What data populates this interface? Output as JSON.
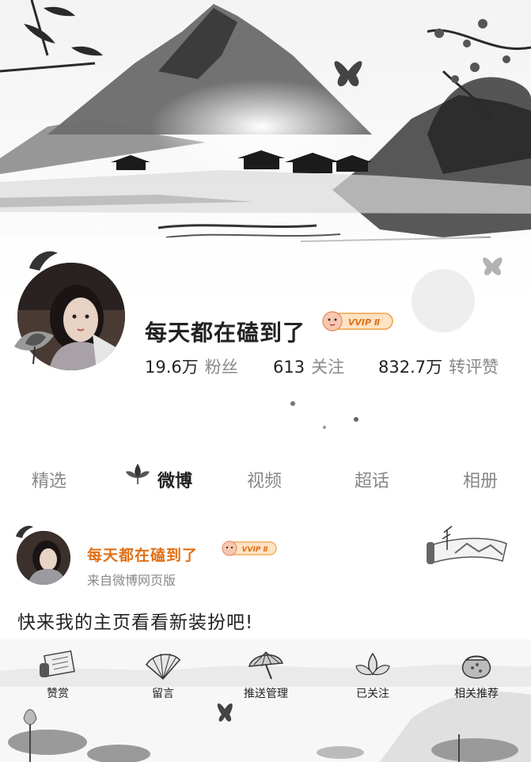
{
  "profile": {
    "username": "每天都在磕到了",
    "vip_badge": "VVIP Ⅱ",
    "stats": [
      {
        "value": "19.6万",
        "label": "粉丝"
      },
      {
        "value": "613",
        "label": "关注"
      },
      {
        "value": "832.7万",
        "label": "转评赞"
      }
    ]
  },
  "tabs": [
    {
      "label": "精选",
      "active": false
    },
    {
      "label": "微博",
      "active": true
    },
    {
      "label": "视频",
      "active": false
    },
    {
      "label": "超话",
      "active": false
    },
    {
      "label": "相册",
      "active": false
    }
  ],
  "post": {
    "author": "每天都在磕到了",
    "vip_badge": "VVIP Ⅱ",
    "source": "来自微博网页版",
    "text": "快来我的主页看看新装扮吧!"
  },
  "actions": [
    {
      "label": "赞赏",
      "icon": "scroll-icon"
    },
    {
      "label": "留言",
      "icon": "folding-fan-icon"
    },
    {
      "label": "推送管理",
      "icon": "umbrella-icon"
    },
    {
      "label": "已关注",
      "icon": "lotus-icon"
    },
    {
      "label": "相关推荐",
      "icon": "pouch-icon"
    }
  ],
  "colors": {
    "name_orange": "#e07018",
    "vip_orange": "#f0a040",
    "text_dark": "#222222",
    "text_gray": "#888888"
  }
}
